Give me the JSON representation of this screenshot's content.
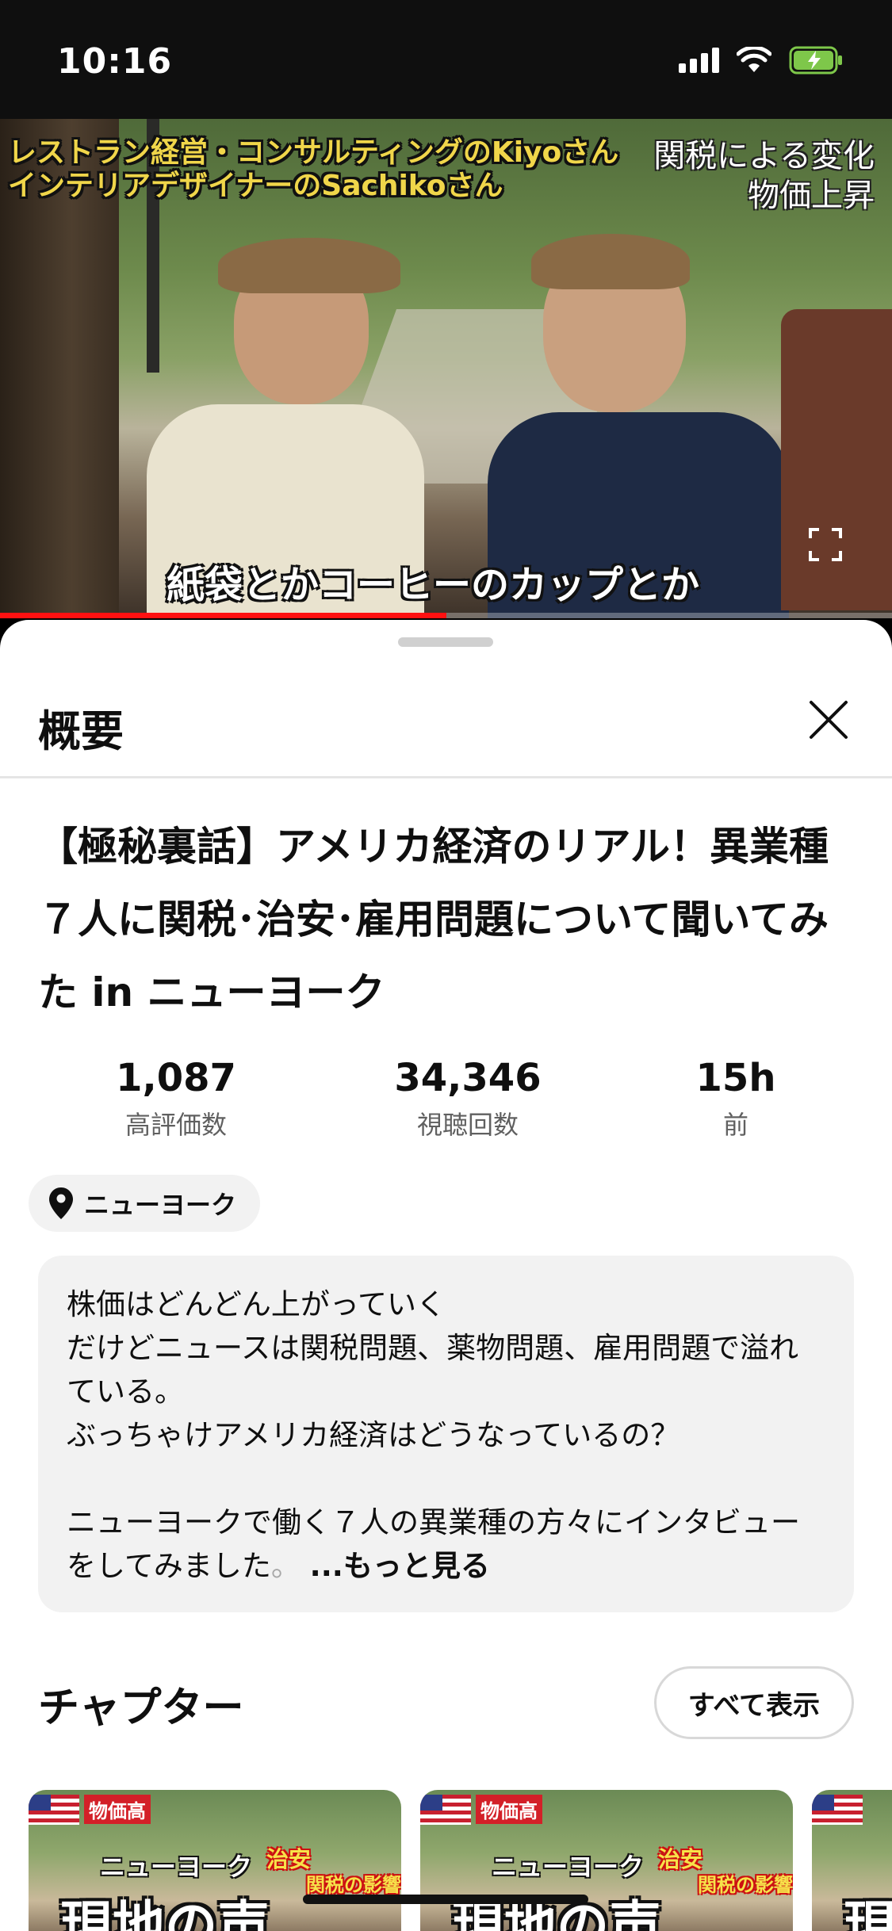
{
  "status_bar": {
    "time": "10:16"
  },
  "video": {
    "overlay_top_left": [
      "レストラン経営・コンサルティングのKiyoさん",
      "インテリアデザイナーのSachikoさん"
    ],
    "overlay_top_right": [
      "関税による変化",
      "物価上昇"
    ],
    "subtitle": "紙袋とかコーヒーのカップとか",
    "progress": 0.5
  },
  "sheet": {
    "title": "概要",
    "video_title": "【極秘裏話】アメリカ経済のリアル！異業種７人に関税･治安･雇用問題について聞いてみた in ニューヨーク",
    "stats": [
      {
        "value": "1,087",
        "label": "高評価数"
      },
      {
        "value": "34,346",
        "label": "視聴回数"
      },
      {
        "value": "15h",
        "label": "前"
      }
    ],
    "location": "ニューヨーク",
    "description": {
      "lines": [
        "株価はどんどん上がっていく",
        "だけどニュースは関税問題、薬物問題、雇用問題で溢れている。",
        "ぶっちゃけアメリカ経済はどうなっているの？",
        "",
        "ニューヨークで働く７人の異業種の方々にインタビューをしてみました"
      ],
      "fade_text": "。",
      "more": "...もっと見る"
    },
    "chapters_title": "チャプター",
    "show_all": "すべて表示",
    "chapters": [
      {
        "tag1": "物価高",
        "tag2": "ニューヨーク",
        "tag3": "治安",
        "tag4": "関税の影響",
        "big": "現地の声"
      },
      {
        "tag1": "物価高",
        "tag2": "ニューヨーク",
        "tag3": "治安",
        "tag4": "関税の影響",
        "big": "現地の声"
      },
      {
        "tag1": "",
        "tag2": "",
        "tag3": "",
        "tag4": "",
        "big": "現"
      }
    ]
  },
  "colors": {
    "accent": "#ff0000",
    "text": "#0f0f0f",
    "secondary": "#606060",
    "chip_bg": "#f2f2f2"
  }
}
